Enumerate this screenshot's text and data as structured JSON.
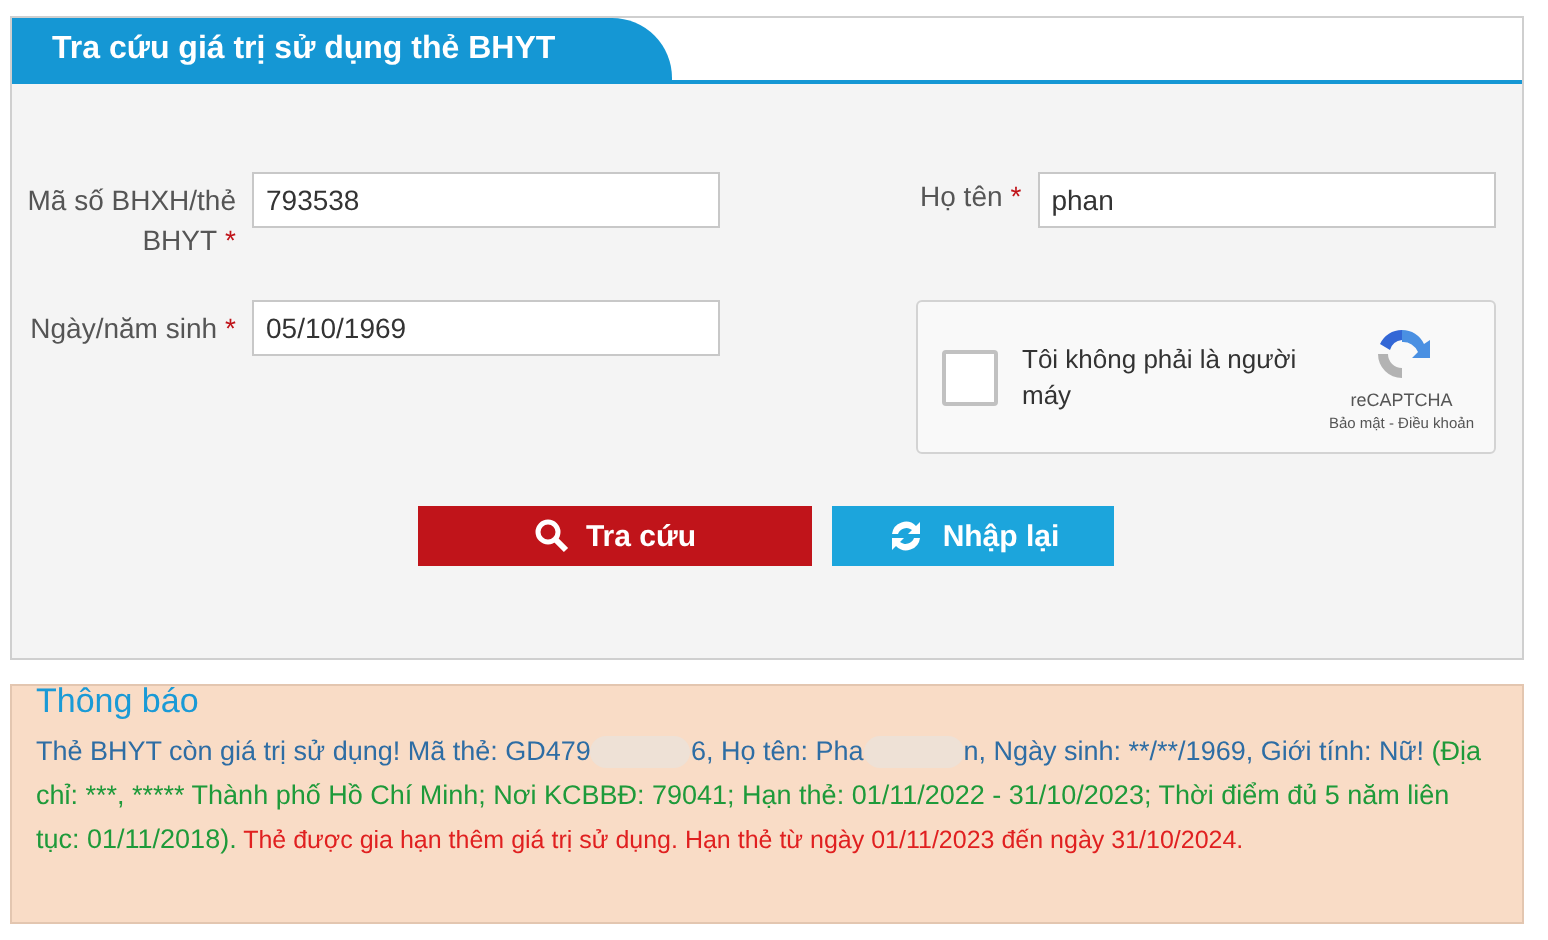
{
  "panel": {
    "title": "Tra cứu giá trị sử dụng thẻ BHYT",
    "fields": [
      {
        "label": "Mã số BHXH/thẻ BHYT",
        "required_mark": "*",
        "value": "793538"
      },
      {
        "label": "Họ tên",
        "required_mark": "*",
        "value": "phan"
      },
      {
        "label": "Ngày/năm sinh",
        "required_mark": "*",
        "value": "05/10/1969"
      }
    ],
    "captcha": {
      "label": "Tôi không phải là người máy",
      "checked": false,
      "brand": "reCAPTCHA",
      "links": "Bảo mật - Điều khoản"
    },
    "buttons": [
      {
        "kind": "search",
        "label": "Tra cứu"
      },
      {
        "kind": "reset",
        "label": "Nhập lại"
      }
    ]
  },
  "notice": {
    "title": "Thông báo",
    "segments": [
      {
        "kind": "info",
        "text": "Thẻ BHYT còn giá trị sử dụng! Mã thẻ: GD479"
      },
      {
        "kind": "redacted"
      },
      {
        "kind": "info",
        "text": "6, Họ tên: Pha"
      },
      {
        "kind": "redacted"
      },
      {
        "kind": "info",
        "text": "n, Ngày sinh: **/**/1969, Giới tính: Nữ!"
      },
      {
        "kind": "detail",
        "text": " (Địa chỉ: ***, ***** Thành phố Hồ Chí Minh; Nơi KCBBĐ: 79041; Hạn thẻ: 01/11/2022 - 31/10/2023; Thời điểm đủ 5 năm liên tục: 01/11/2018)."
      },
      {
        "kind": "alert",
        "text": " Thẻ được gia hạn thêm giá trị sử dụng. Hạn thẻ từ ngày 01/11/2023 đến ngày 31/10/2024."
      }
    ]
  }
}
